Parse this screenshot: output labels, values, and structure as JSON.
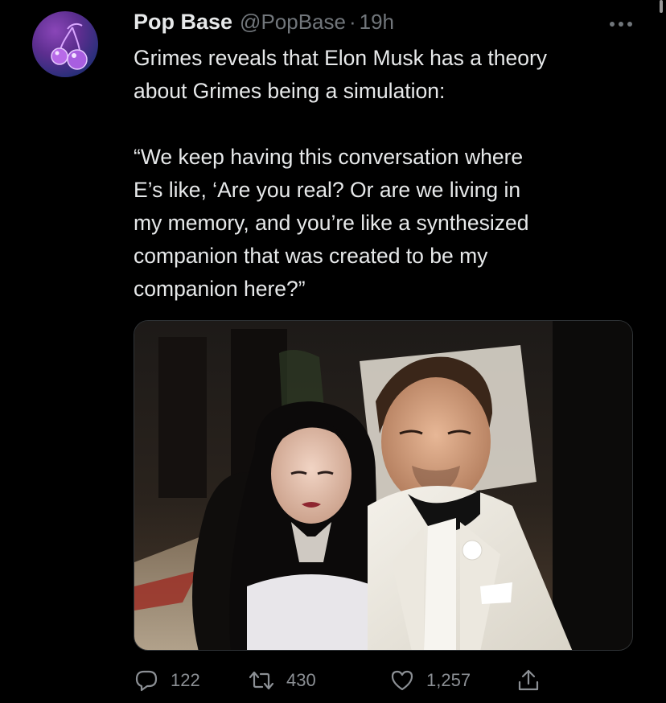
{
  "tweet": {
    "display_name": "Pop Base",
    "handle": "@PopBase",
    "separator": "·",
    "timestamp": "19h",
    "avatar_icon": "cherries-icon",
    "text": "Grimes reveals that Elon Musk has a theory\nabout Grimes being a simulation:\n\n“We keep having this conversation where\nE’s like, ‘Are you real? Or are we living in\nmy memory, and you’re like a synthesized\ncompanion that was created to be my\ncompanion here?”",
    "media": {
      "type": "photo"
    }
  },
  "actions": {
    "reply_count": "122",
    "retweet_count": "430",
    "like_count": "1,257"
  },
  "colors": {
    "background": "#000000",
    "primary_text": "#e7e9ea",
    "secondary_text": "#71767b"
  }
}
